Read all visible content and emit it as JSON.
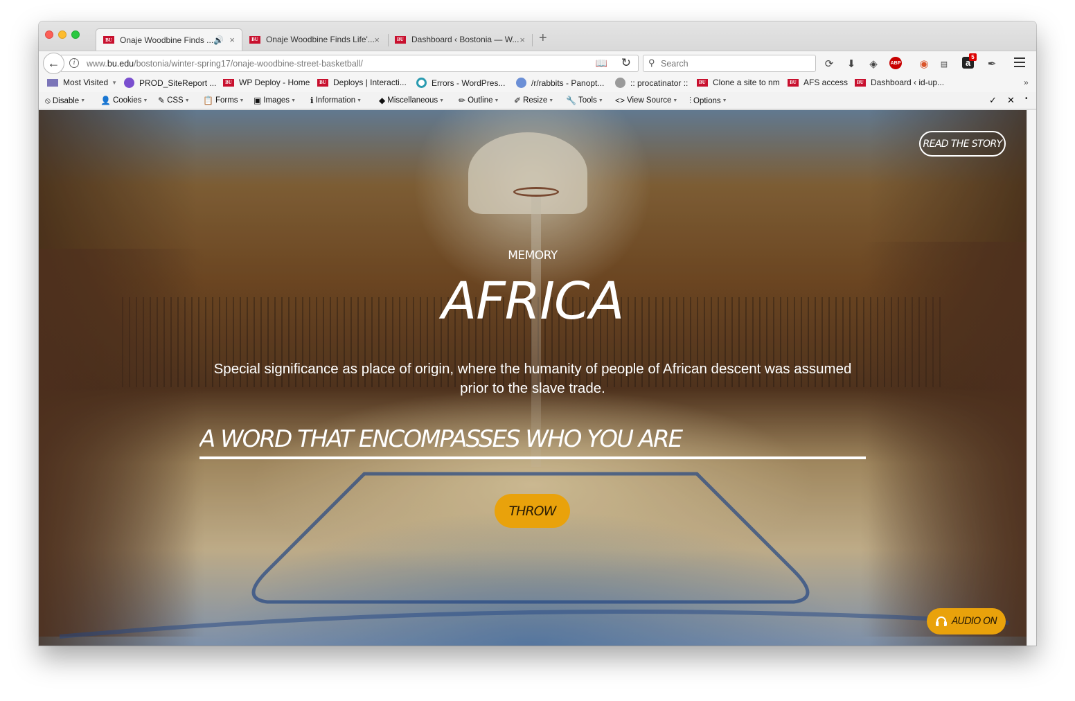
{
  "browser": {
    "tabs": [
      {
        "label": "Onaje Woodbine Finds ...",
        "favicon": "BU",
        "audio": true,
        "active": true
      },
      {
        "label": "Onaje Woodbine Finds Life'...",
        "favicon": "BU",
        "active": false
      },
      {
        "label": "Dashboard ‹ Bostonia — W...",
        "favicon": "BU",
        "active": false
      }
    ],
    "close_glyph": "×",
    "new_tab_glyph": "+",
    "url": {
      "prefix": "www.",
      "domain": "bu.edu",
      "path": "/bostonia/winter-spring17/onaje-woodbine-street-basketball/"
    },
    "search_placeholder": "Search",
    "extension_badge": "5",
    "abp_label": "ABP",
    "amazon_label": "a"
  },
  "bookmarks": [
    {
      "label": "Most Visited",
      "icon": "calendar-icon",
      "dropdown": true
    },
    {
      "label": "PROD_SiteReport ...",
      "icon": "purple-circle-icon"
    },
    {
      "label": "WP Deploy - Home",
      "icon": "bu-icon"
    },
    {
      "label": "Deploys | Interacti...",
      "icon": "bu-icon"
    },
    {
      "label": "Errors - WordPres...",
      "icon": "teal-ring-icon"
    },
    {
      "label": "/r/rabbits - Panopt...",
      "icon": "shield-icon"
    },
    {
      "label": ":: procatinator ::",
      "icon": "globe-icon"
    },
    {
      "label": "Clone a site to nm",
      "icon": "bu-icon"
    },
    {
      "label": "AFS access",
      "icon": "bu-icon"
    },
    {
      "label": "Dashboard ‹ id-up...",
      "icon": "bu-icon"
    }
  ],
  "bookmarks_overflow": "»",
  "dev_toolbar": [
    {
      "label": "Disable",
      "icon": "⦸"
    },
    {
      "label": "Cookies",
      "icon": "👤"
    },
    {
      "label": "CSS",
      "icon": "✎"
    },
    {
      "label": "Forms",
      "icon": "📋"
    },
    {
      "label": "Images",
      "icon": "▣"
    },
    {
      "label": "Information",
      "icon": "ℹ"
    },
    {
      "label": "Miscellaneous",
      "icon": "◆"
    },
    {
      "label": "Outline",
      "icon": "✏"
    },
    {
      "label": "Resize",
      "icon": "✐"
    },
    {
      "label": "Tools",
      "icon": "🔧"
    },
    {
      "label": "View Source",
      "icon": "<>"
    },
    {
      "label": "Options",
      "icon": "⫶"
    }
  ],
  "dev_toolbar_right": {
    "check": "✓",
    "close": "✕",
    "dot": "•"
  },
  "page": {
    "read_story_label": "READ THE STORY",
    "category": "MEMORY",
    "word": "AFRICA",
    "definition": "Special significance as place of origin, where the humanity of people of African descent was assumed prior to the slave trade.",
    "input_placeholder": "A WORD THAT ENCOMPASSES WHO YOU ARE",
    "throw_label": "THROW",
    "audio_label": "AUDIO ON",
    "accent_color": "#e9a20b"
  }
}
